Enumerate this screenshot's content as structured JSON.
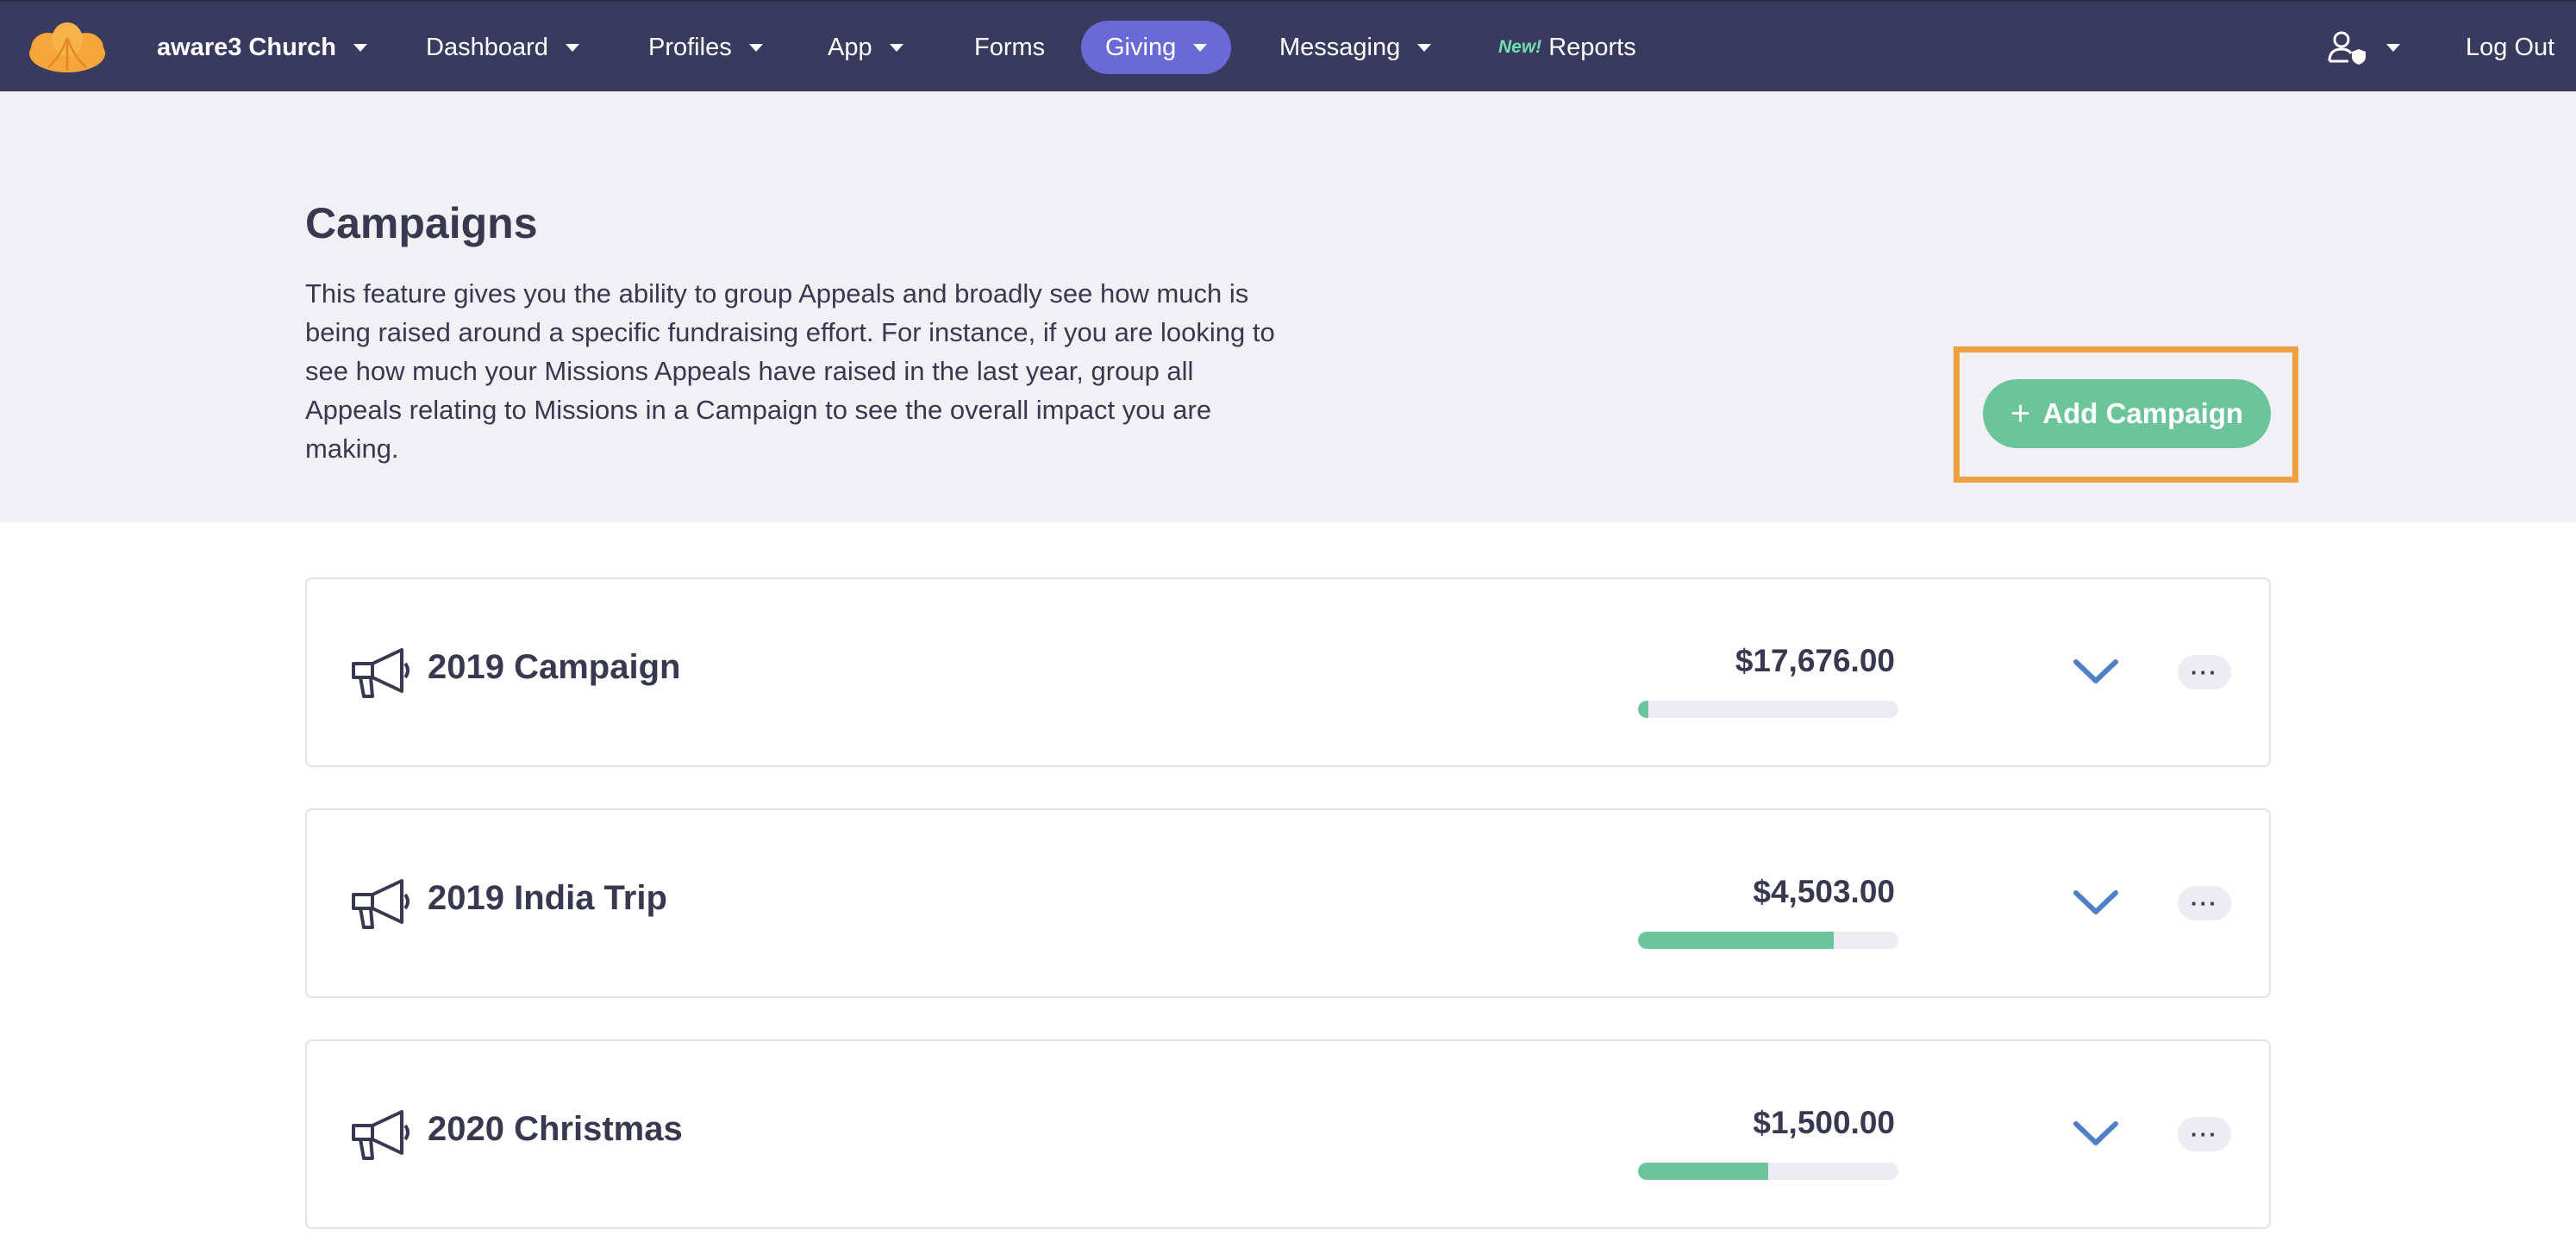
{
  "colors": {
    "nav_bg": "#3a3a5e",
    "nav_active": "#6a6ad6",
    "accent_green": "#6cc59a",
    "highlight_orange": "#f0a040",
    "chevron_blue": "#4f7fc4"
  },
  "nav": {
    "org_name": "aware3 Church",
    "items": [
      {
        "label": "Dashboard"
      },
      {
        "label": "Profiles"
      },
      {
        "label": "App"
      },
      {
        "label": "Forms"
      },
      {
        "label": "Giving"
      },
      {
        "label": "Messaging"
      },
      {
        "label": "Reports",
        "badge": "New!"
      }
    ],
    "logout_label": "Log Out",
    "user_icon": "user-shield-icon"
  },
  "header": {
    "title": "Campaigns",
    "description": "This feature gives you the ability to group Appeals and broadly see how much is being raised around a specific fundraising effort. For instance, if you are looking to see how much your Missions Appeals have raised in the last year, group all Appeals relating to Missions in a Campaign to see the overall impact you are making.",
    "add_button_label": "Add Campaign",
    "add_button_icon": "plus-icon"
  },
  "campaigns": [
    {
      "name": "2019 Campaign",
      "amount": "$17,676.00",
      "progress": 0.04,
      "more_label": "···"
    },
    {
      "name": "2019 India Trip",
      "amount": "$4,503.00",
      "progress": 0.75,
      "more_label": "···"
    },
    {
      "name": "2020 Christmas",
      "amount": "$1,500.00",
      "progress": 0.5,
      "more_label": "···"
    }
  ]
}
